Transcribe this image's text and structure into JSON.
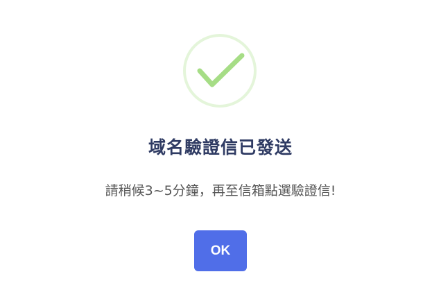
{
  "dialog": {
    "icon": "check-circle-icon",
    "title": "域名驗證信已發送",
    "message": "請稍候3~5分鐘，再至信箱點選驗證信!",
    "ok_label": "OK"
  },
  "colors": {
    "icon_ring": "#e4f5da",
    "icon_check": "#a6dd86",
    "title": "#2f3b63",
    "message": "#555555",
    "button_bg": "#506ee8",
    "button_text": "#ffffff"
  }
}
